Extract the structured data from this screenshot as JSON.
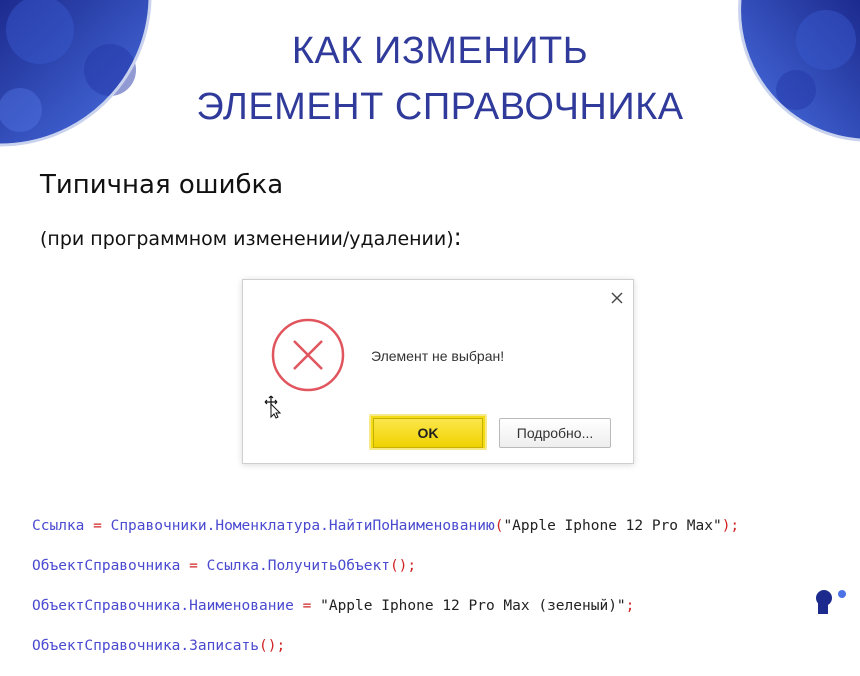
{
  "slide": {
    "title_line1": "КАК ИЗМЕНИТЬ",
    "title_line2": "ЭЛЕМЕНТ СПРАВОЧНИКА",
    "subtitle": "Типичная ошибка",
    "note_text": "(при программном изменении/удалении)",
    "note_colon": ":"
  },
  "dialog": {
    "message": "Элемент не выбран!",
    "ok_label": "OK",
    "details_label": "Подробно..."
  },
  "code": {
    "line1": {
      "lhs": "Ссылка",
      "op": " = ",
      "expr": "Справочники.Номенклатура.НайтиПоНаименованию",
      "open": "(",
      "arg": "\"Apple Iphone 12 Pro Max\"",
      "close": ");"
    },
    "line2": {
      "lhs": "ОбъектСправочника",
      "op": " = ",
      "expr": "Ссылка.ПолучитьОбъект",
      "call": "();"
    },
    "line3": {
      "lhs": "ОбъектСправочника.Наименование",
      "op": " = ",
      "arg": "\"Apple Iphone 12 Pro Max (зеленый)\"",
      "end": ";"
    },
    "line4": {
      "lhs": "ОбъектСправочника.Записать",
      "call": "();"
    }
  },
  "colors": {
    "title": "#2f3a9a",
    "corner_dark": "#1c2a8e",
    "corner_light": "#4b73e6",
    "error_ring": "#e0555e",
    "ok_button": "#f3dc14",
    "code_identifier": "#4a4ad0",
    "code_operator": "#d02424"
  }
}
